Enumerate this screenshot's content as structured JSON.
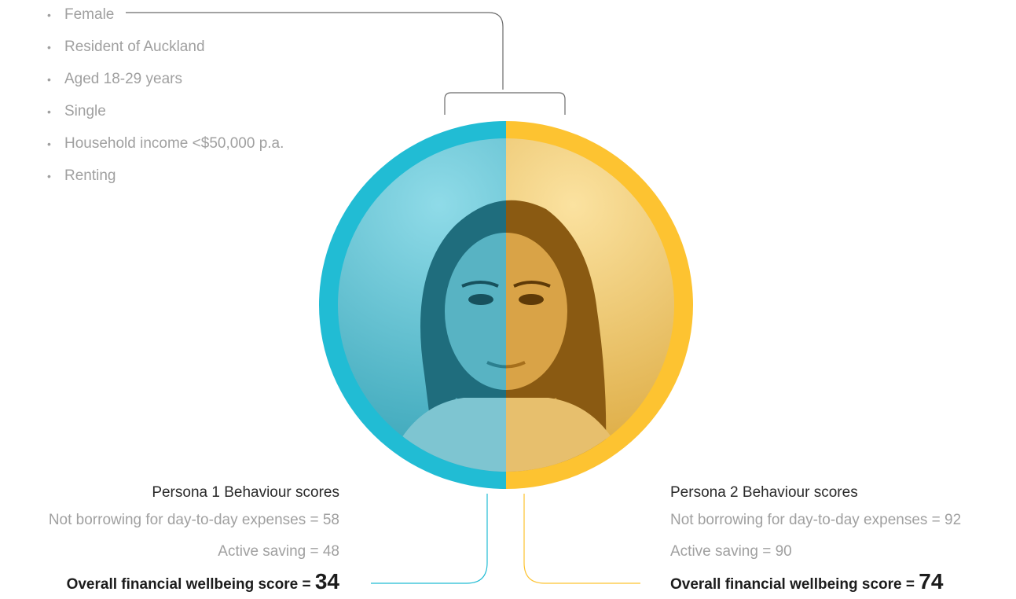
{
  "attributes": [
    "Female",
    "Resident of Auckland",
    "Aged 18-29 years",
    "Single",
    "Household income <$50,000 p.a.",
    "Renting"
  ],
  "bullet": "•",
  "persona1": {
    "title": "Persona 1 Behaviour scores",
    "borrowing_label": "Not borrowing for day-to-day expenses = 58",
    "saving_label": "Active saving = 48",
    "overall_prefix": "Overall financial wellbeing score = ",
    "overall_value": "34"
  },
  "persona2": {
    "title": "Persona 2 Behaviour scores",
    "borrowing_label": "Not borrowing for day-to-day expenses = 92",
    "saving_label": "Active saving = 90",
    "overall_prefix": "Overall financial wellbeing score = ",
    "overall_value": "74"
  },
  "colors": {
    "persona1": "#21bcd4",
    "persona2": "#fdc331",
    "text_muted": "#a0a0a0",
    "text_dark": "#1c1c1c",
    "connector": "#6a6a6a"
  },
  "icons": {
    "portrait": "split-woman-portrait"
  }
}
